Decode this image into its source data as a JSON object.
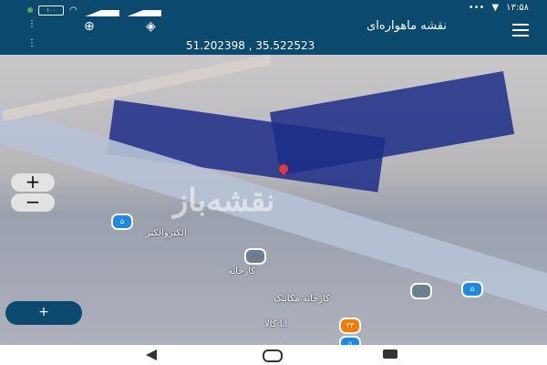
{
  "status_bar": {
    "time": "۱۳:۵۸",
    "battery": "۱۰۰",
    "left_icons": [
      "whatsapp-icon",
      "battery-icon",
      "wifi-icon",
      "signal-icon",
      "signal-icon"
    ],
    "right_icons": [
      "dots-icon",
      "chat-icon"
    ]
  },
  "header": {
    "title": "نقشه ماهواره‌ای",
    "menu_icon": "hamburger-icon",
    "locate_icon": "locate-icon",
    "layers_icon": "layers-icon"
  },
  "coords": {
    "text": "51.202398 , 35.522523"
  },
  "map": {
    "labels": [
      {
        "text": "الکتروالکتر",
        "id": "lbl-1"
      },
      {
        "text": "کارخانه",
        "id": "lbl-2"
      },
      {
        "text": "کارخانه مکانیک",
        "id": "lbl-3"
      },
      {
        "text": "انا کالا",
        "id": "lbl-4"
      }
    ],
    "watermark": "نقشه‌باز",
    "orange_pin": "۲۴"
  },
  "zoom": {
    "in": "+",
    "out": "−"
  },
  "fab": {
    "label": "+"
  },
  "navbar": {
    "items": [
      "back-icon",
      "home-icon",
      "recent-icon"
    ]
  }
}
